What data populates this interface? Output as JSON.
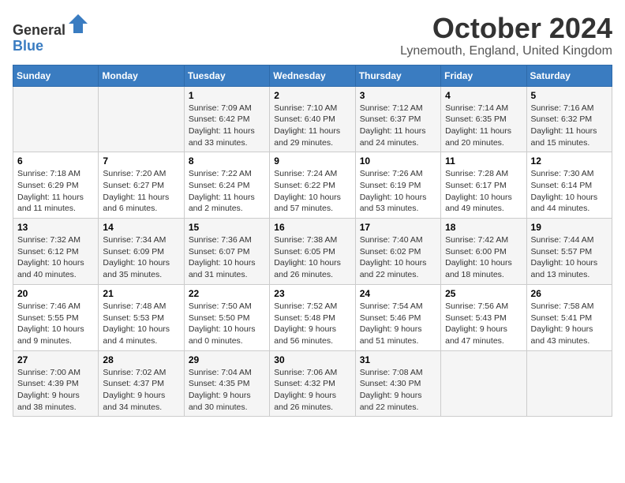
{
  "header": {
    "logo_general": "General",
    "logo_blue": "Blue",
    "month_title": "October 2024",
    "location": "Lynemouth, England, United Kingdom"
  },
  "days_of_week": [
    "Sunday",
    "Monday",
    "Tuesday",
    "Wednesday",
    "Thursday",
    "Friday",
    "Saturday"
  ],
  "weeks": [
    [
      {
        "day": "",
        "info": ""
      },
      {
        "day": "",
        "info": ""
      },
      {
        "day": "1",
        "info": "Sunrise: 7:09 AM\nSunset: 6:42 PM\nDaylight: 11 hours\nand 33 minutes."
      },
      {
        "day": "2",
        "info": "Sunrise: 7:10 AM\nSunset: 6:40 PM\nDaylight: 11 hours\nand 29 minutes."
      },
      {
        "day": "3",
        "info": "Sunrise: 7:12 AM\nSunset: 6:37 PM\nDaylight: 11 hours\nand 24 minutes."
      },
      {
        "day": "4",
        "info": "Sunrise: 7:14 AM\nSunset: 6:35 PM\nDaylight: 11 hours\nand 20 minutes."
      },
      {
        "day": "5",
        "info": "Sunrise: 7:16 AM\nSunset: 6:32 PM\nDaylight: 11 hours\nand 15 minutes."
      }
    ],
    [
      {
        "day": "6",
        "info": "Sunrise: 7:18 AM\nSunset: 6:29 PM\nDaylight: 11 hours\nand 11 minutes."
      },
      {
        "day": "7",
        "info": "Sunrise: 7:20 AM\nSunset: 6:27 PM\nDaylight: 11 hours\nand 6 minutes."
      },
      {
        "day": "8",
        "info": "Sunrise: 7:22 AM\nSunset: 6:24 PM\nDaylight: 11 hours\nand 2 minutes."
      },
      {
        "day": "9",
        "info": "Sunrise: 7:24 AM\nSunset: 6:22 PM\nDaylight: 10 hours\nand 57 minutes."
      },
      {
        "day": "10",
        "info": "Sunrise: 7:26 AM\nSunset: 6:19 PM\nDaylight: 10 hours\nand 53 minutes."
      },
      {
        "day": "11",
        "info": "Sunrise: 7:28 AM\nSunset: 6:17 PM\nDaylight: 10 hours\nand 49 minutes."
      },
      {
        "day": "12",
        "info": "Sunrise: 7:30 AM\nSunset: 6:14 PM\nDaylight: 10 hours\nand 44 minutes."
      }
    ],
    [
      {
        "day": "13",
        "info": "Sunrise: 7:32 AM\nSunset: 6:12 PM\nDaylight: 10 hours\nand 40 minutes."
      },
      {
        "day": "14",
        "info": "Sunrise: 7:34 AM\nSunset: 6:09 PM\nDaylight: 10 hours\nand 35 minutes."
      },
      {
        "day": "15",
        "info": "Sunrise: 7:36 AM\nSunset: 6:07 PM\nDaylight: 10 hours\nand 31 minutes."
      },
      {
        "day": "16",
        "info": "Sunrise: 7:38 AM\nSunset: 6:05 PM\nDaylight: 10 hours\nand 26 minutes."
      },
      {
        "day": "17",
        "info": "Sunrise: 7:40 AM\nSunset: 6:02 PM\nDaylight: 10 hours\nand 22 minutes."
      },
      {
        "day": "18",
        "info": "Sunrise: 7:42 AM\nSunset: 6:00 PM\nDaylight: 10 hours\nand 18 minutes."
      },
      {
        "day": "19",
        "info": "Sunrise: 7:44 AM\nSunset: 5:57 PM\nDaylight: 10 hours\nand 13 minutes."
      }
    ],
    [
      {
        "day": "20",
        "info": "Sunrise: 7:46 AM\nSunset: 5:55 PM\nDaylight: 10 hours\nand 9 minutes."
      },
      {
        "day": "21",
        "info": "Sunrise: 7:48 AM\nSunset: 5:53 PM\nDaylight: 10 hours\nand 4 minutes."
      },
      {
        "day": "22",
        "info": "Sunrise: 7:50 AM\nSunset: 5:50 PM\nDaylight: 10 hours\nand 0 minutes."
      },
      {
        "day": "23",
        "info": "Sunrise: 7:52 AM\nSunset: 5:48 PM\nDaylight: 9 hours\nand 56 minutes."
      },
      {
        "day": "24",
        "info": "Sunrise: 7:54 AM\nSunset: 5:46 PM\nDaylight: 9 hours\nand 51 minutes."
      },
      {
        "day": "25",
        "info": "Sunrise: 7:56 AM\nSunset: 5:43 PM\nDaylight: 9 hours\nand 47 minutes."
      },
      {
        "day": "26",
        "info": "Sunrise: 7:58 AM\nSunset: 5:41 PM\nDaylight: 9 hours\nand 43 minutes."
      }
    ],
    [
      {
        "day": "27",
        "info": "Sunrise: 7:00 AM\nSunset: 4:39 PM\nDaylight: 9 hours\nand 38 minutes."
      },
      {
        "day": "28",
        "info": "Sunrise: 7:02 AM\nSunset: 4:37 PM\nDaylight: 9 hours\nand 34 minutes."
      },
      {
        "day": "29",
        "info": "Sunrise: 7:04 AM\nSunset: 4:35 PM\nDaylight: 9 hours\nand 30 minutes."
      },
      {
        "day": "30",
        "info": "Sunrise: 7:06 AM\nSunset: 4:32 PM\nDaylight: 9 hours\nand 26 minutes."
      },
      {
        "day": "31",
        "info": "Sunrise: 7:08 AM\nSunset: 4:30 PM\nDaylight: 9 hours\nand 22 minutes."
      },
      {
        "day": "",
        "info": ""
      },
      {
        "day": "",
        "info": ""
      }
    ]
  ]
}
